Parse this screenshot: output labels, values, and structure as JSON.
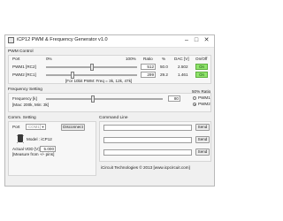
{
  "window": {
    "title": "iCP12 PWM & Frequency Generator v1.0",
    "minimize": "–",
    "maximize": "□",
    "close": "✕",
    "accent_on_color": "#8fe46b"
  },
  "pwm_control": {
    "section_label": "PWM Control",
    "headers": {
      "port": "Port",
      "zero": "0%",
      "hundred": "100%",
      "ratio": "Ratio",
      "pct": "%",
      "dac": "DAC [V]",
      "onoff": "On/Off"
    },
    "channels": [
      {
        "name": "PWM1 [RC2]",
        "ratio": "512",
        "pct": "50.0",
        "dac": "2.502",
        "button": "On",
        "slider_fraction": 0.5
      },
      {
        "name": "PWM2 [RC1]",
        "ratio": "299",
        "pct": "29.2",
        "dac": "1.461",
        "button": "On",
        "slider_fraction": 0.292
      }
    ],
    "note": "[For 10bit PWM: Freq = 3k, 12k, 47k]"
  },
  "frequency": {
    "section_label": "Frequency Setting",
    "label": "Frequency [k]",
    "range": "[Max: 200k, Min: 3k]",
    "value": "80",
    "slider_fraction": 0.4,
    "ratio_label": "50% Ratio",
    "options": [
      "PWM1",
      "PWM2"
    ]
  },
  "comm": {
    "section_label": "Comm. Setting",
    "port_label": "Port",
    "port_value": "COM1",
    "disconnect": "Disconnect",
    "model_label": "Model : iCP12",
    "vdd_label": "Actual VDD [V] :",
    "vdd_value": "5.000",
    "vdd_note": "[Measure from +/- pins]"
  },
  "command": {
    "section_label": "Command Line",
    "send": "Send"
  },
  "footer": "iCircuit Technologies © 2013 [www.icpcircuit.com]"
}
